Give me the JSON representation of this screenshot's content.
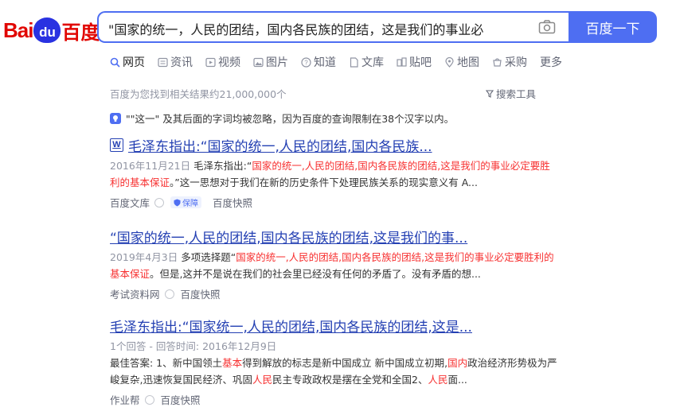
{
  "logo": {
    "bai": "Bai",
    "paw": "du",
    "du": "百度"
  },
  "search": {
    "value": "\"国家的统一，人民的团结，国内各民族的团结，这是我们的事业必",
    "button": "百度一下"
  },
  "tabs": [
    {
      "label": "网页",
      "icon": "search-icon",
      "active": true
    },
    {
      "label": "资讯",
      "icon": "news-icon"
    },
    {
      "label": "视频",
      "icon": "video-icon"
    },
    {
      "label": "图片",
      "icon": "image-icon"
    },
    {
      "label": "知道",
      "icon": "question-icon"
    },
    {
      "label": "文库",
      "icon": "document-icon"
    },
    {
      "label": "贴吧",
      "icon": "tieba-icon"
    },
    {
      "label": "地图",
      "icon": "map-icon"
    },
    {
      "label": "采购",
      "icon": "cart-icon"
    },
    {
      "label": "更多"
    }
  ],
  "result_count": "百度为您找到相关结果约21,000,000个",
  "search_tools": "搜索工具",
  "notice": "\"\"这一\" 及其后面的字词均被忽略，因为百度的查询限制在38个汉字以内。",
  "colors": {
    "accent": "#4e6ef2",
    "link": "#2440b3",
    "highlight": "#f73131"
  },
  "results": [
    {
      "title": "毛泽东指出:“国家的统一,人民的团结,国内各民族...",
      "icon": "W",
      "date": "2016年11月21日",
      "abstract_pre": "毛泽东指出:“",
      "abstract_hl": "国家的统一,人民的团结,国内各民族的团结,这是我们的事业必定要胜利的基本保证",
      "abstract_post": "。”这一思想对于我们在新的历史条件下处理民族关系的现实意义有 A...",
      "source": "百度文库",
      "badge": "保障",
      "cache": "百度快照"
    },
    {
      "title": "“国家的统一,人民的团结,国内各民族的团结,这是我们的事...",
      "date": "2019年4月3日",
      "abstract_pre": "多项选择题“",
      "abstract_hl": "国家的统一,人民的团结,国内各民族的团结,这是我们的事业必定要胜利的基本保证",
      "abstract_post": "。但是,这并不是说在我们的社会里已经没有任何的矛盾了。没有矛盾的想...",
      "source": "考试资料网",
      "cache": "百度快照"
    },
    {
      "title": "毛泽东指出:“国家统一,人民的团结,国内各民族的团结,这是...",
      "meta": "1个回答 - 回答时间: 2016年12月9日",
      "abstract_a": "最佳答案: 1、新中国领土",
      "abstract_hl1": "基本",
      "abstract_b": "得到解放的标志是新中国成立 新中国成立初期,",
      "abstract_hl2": "国内",
      "abstract_c": "政治经济形势极为严峻复杂,迅速恢复国民经济、巩固",
      "abstract_hl3": "人民",
      "abstract_d": "民主专政政权是摆在全党和全国2、",
      "abstract_hl4": "人民",
      "abstract_e": "面...",
      "source": "作业帮",
      "cache": "百度快照"
    }
  ]
}
